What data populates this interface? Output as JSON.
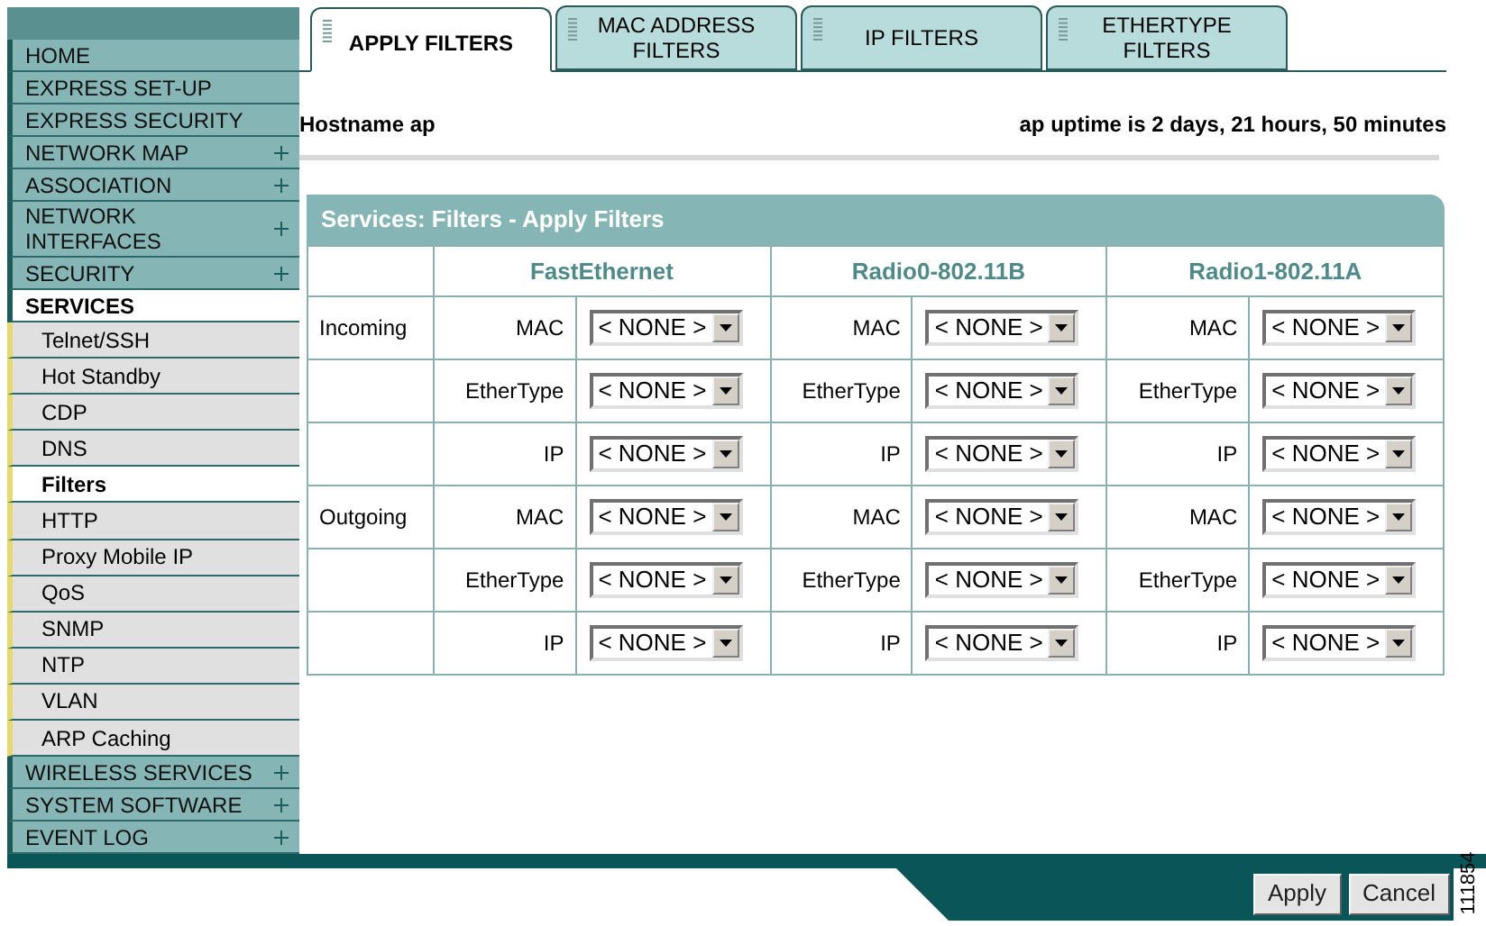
{
  "sidebar": {
    "items": [
      {
        "label": "HOME",
        "expandable": false,
        "selected": false
      },
      {
        "label": "EXPRESS SET-UP",
        "expandable": false,
        "selected": false
      },
      {
        "label": "EXPRESS SECURITY",
        "expandable": false,
        "selected": false
      },
      {
        "label": "NETWORK MAP",
        "expandable": true,
        "selected": false
      },
      {
        "label": "ASSOCIATION",
        "expandable": true,
        "selected": false
      },
      {
        "label": "NETWORK INTERFACES",
        "expandable": true,
        "selected": false
      },
      {
        "label": "SECURITY",
        "expandable": true,
        "selected": false
      },
      {
        "label": "SERVICES",
        "expandable": false,
        "selected": true,
        "children": [
          {
            "label": "Telnet/SSH",
            "selected": false
          },
          {
            "label": "Hot Standby",
            "selected": false
          },
          {
            "label": "CDP",
            "selected": false
          },
          {
            "label": "DNS",
            "selected": false
          },
          {
            "label": "Filters",
            "selected": true
          },
          {
            "label": "HTTP",
            "selected": false
          },
          {
            "label": "Proxy Mobile IP",
            "selected": false
          },
          {
            "label": "QoS",
            "selected": false
          },
          {
            "label": "SNMP",
            "selected": false
          },
          {
            "label": "NTP",
            "selected": false
          },
          {
            "label": "VLAN",
            "selected": false
          },
          {
            "label": "ARP Caching",
            "selected": false
          }
        ]
      },
      {
        "label": "WIRELESS SERVICES",
        "expandable": true,
        "selected": false
      },
      {
        "label": "SYSTEM SOFTWARE",
        "expandable": true,
        "selected": false
      },
      {
        "label": "EVENT LOG",
        "expandable": true,
        "selected": false
      }
    ]
  },
  "tabs": [
    {
      "label": "APPLY FILTERS",
      "selected": true
    },
    {
      "label": "MAC ADDRESS FILTERS",
      "selected": false
    },
    {
      "label": "IP FILTERS",
      "selected": false
    },
    {
      "label": "ETHERTYPE FILTERS",
      "selected": false
    }
  ],
  "hostname": "Hostname  ap",
  "uptime": "ap uptime is 2 days, 21 hours, 50 minutes",
  "table": {
    "title": "Services: Filters - Apply Filters",
    "columns": [
      "FastEthernet",
      "Radio0-802.11B",
      "Radio1-802.11A"
    ],
    "rows": [
      {
        "direction": "Incoming",
        "cells": [
          {
            "label": "MAC",
            "value": "< NONE >"
          },
          {
            "label": "MAC",
            "value": "< NONE >"
          },
          {
            "label": "MAC",
            "value": "< NONE >"
          }
        ]
      },
      {
        "cells": [
          {
            "label": "EtherType",
            "value": "< NONE >"
          },
          {
            "label": "EtherType",
            "value": "< NONE >"
          },
          {
            "label": "EtherType",
            "value": "< NONE >"
          }
        ]
      },
      {
        "cells": [
          {
            "label": "IP",
            "value": "< NONE >"
          },
          {
            "label": "IP",
            "value": "< NONE >"
          },
          {
            "label": "IP",
            "value": "< NONE >"
          }
        ]
      },
      {
        "direction": "Outgoing",
        "cells": [
          {
            "label": "MAC",
            "value": "< NONE >"
          },
          {
            "label": "MAC",
            "value": "< NONE >"
          },
          {
            "label": "MAC",
            "value": "< NONE >"
          }
        ]
      },
      {
        "cells": [
          {
            "label": "EtherType",
            "value": "< NONE >"
          },
          {
            "label": "EtherType",
            "value": "< NONE >"
          },
          {
            "label": "EtherType",
            "value": "< NONE >"
          }
        ]
      },
      {
        "cells": [
          {
            "label": "IP",
            "value": "< NONE >"
          },
          {
            "label": "IP",
            "value": "< NONE >"
          },
          {
            "label": "IP",
            "value": "< NONE >"
          }
        ]
      }
    ]
  },
  "buttons": [
    "Apply",
    "Cancel"
  ],
  "figure_id": "111854"
}
